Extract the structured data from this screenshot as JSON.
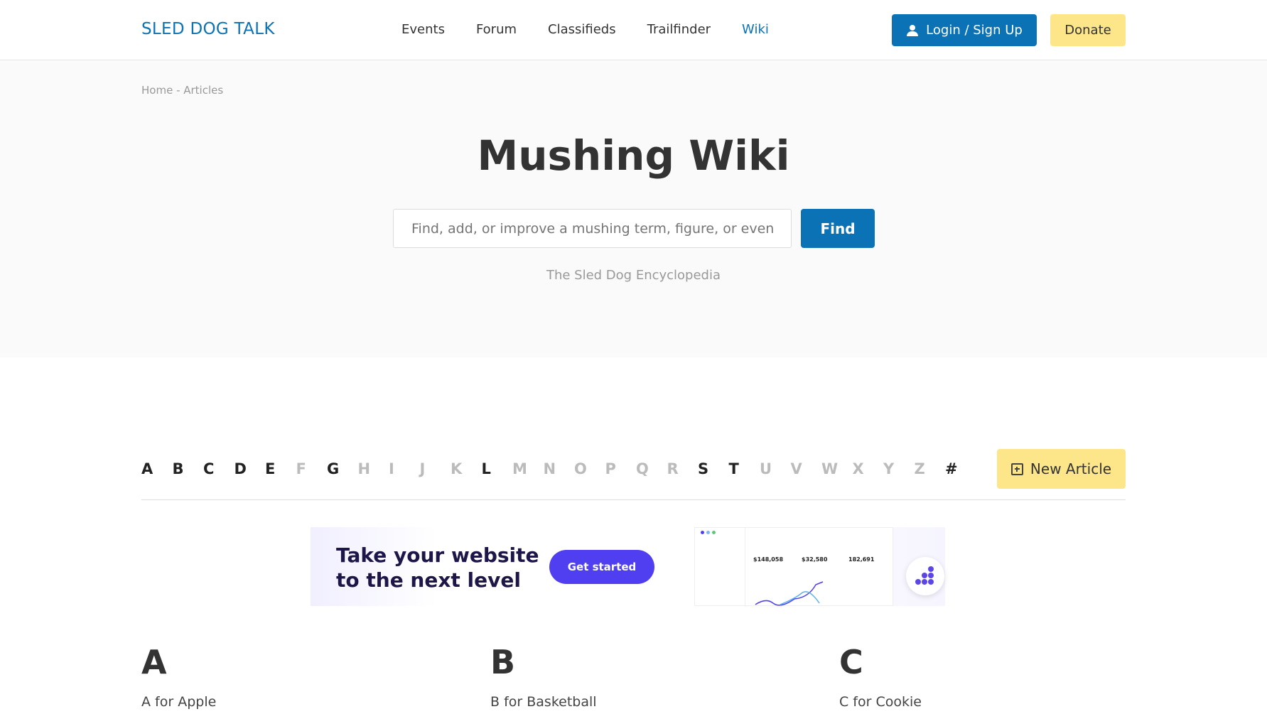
{
  "header": {
    "logo": "SLED DOG TALK",
    "nav": [
      "Events",
      "Forum",
      "Classifieds",
      "Trailfinder",
      "Wiki"
    ],
    "active_nav": "Wiki",
    "login": "Login / Sign Up",
    "donate": "Donate"
  },
  "breadcrumb": "Home - Articles",
  "hero": {
    "title": "Mushing Wiki",
    "search_placeholder": "Find, add, or improve a mushing term, figure, or event",
    "find": "Find",
    "subtitle": "The Sled Dog Encyclopedia"
  },
  "alphabet": {
    "letters": [
      "A",
      "B",
      "C",
      "D",
      "E",
      "F",
      "G",
      "H",
      "I",
      "J",
      "K",
      "L",
      "M",
      "N",
      "O",
      "P",
      "Q",
      "R",
      "S",
      "T",
      "U",
      "V",
      "W",
      "X",
      "Y",
      "Z",
      "#"
    ],
    "active": [
      "A",
      "B",
      "C",
      "D",
      "E",
      "G",
      "L",
      "S",
      "T",
      "#"
    ],
    "new_article": "New Article"
  },
  "ad": {
    "headline_1": "Take your website",
    "headline_2": "to the next level",
    "cta": "Get started",
    "dashboard_stats": [
      "$148,058",
      "$32,580",
      "182,691"
    ]
  },
  "sections": [
    {
      "letter": "A",
      "items": [
        "A for Apple"
      ]
    },
    {
      "letter": "B",
      "items": [
        "B for Basketball"
      ]
    },
    {
      "letter": "C",
      "items": [
        "C for Cookie"
      ]
    }
  ],
  "colors": {
    "brand": "#0b72b5",
    "accent": "#fde68a",
    "ad_button": "#4f3ff0"
  }
}
